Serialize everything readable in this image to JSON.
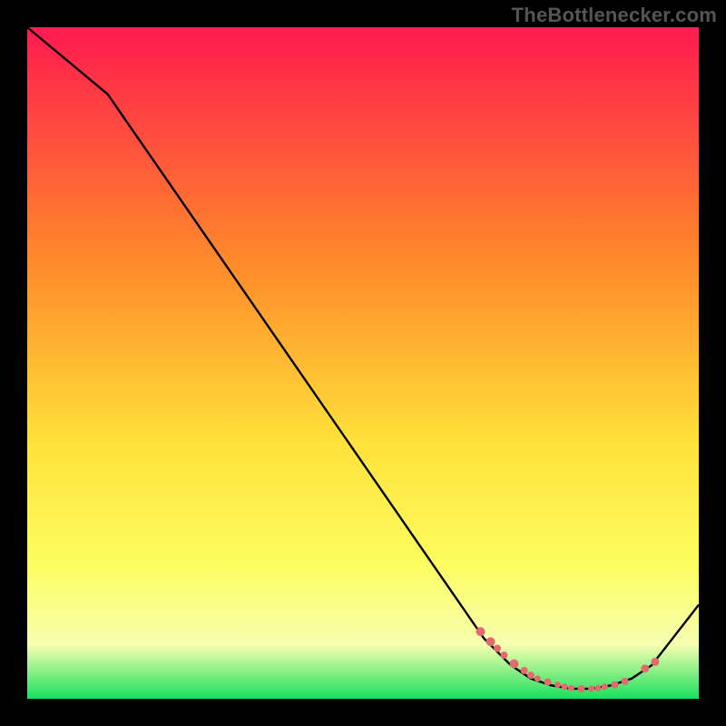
{
  "attribution": "TheBottlenecker.com",
  "colors": {
    "bg": "#000000",
    "gradient_top": "#ff1a4f",
    "gradient_mid1": "#ff8a2a",
    "gradient_mid2": "#ffe23a",
    "gradient_yellow": "#fdfd60",
    "gradient_pale": "#f6ffb0",
    "gradient_bottom": "#18e05b",
    "line": "#000000",
    "marker": "#e46a6d"
  },
  "chart_data": {
    "type": "line",
    "title": "",
    "xlabel": "",
    "ylabel": "",
    "xlim": [
      0,
      100
    ],
    "ylim": [
      0,
      100
    ],
    "series": [
      {
        "name": "curve",
        "x": [
          0,
          12,
          68,
          72,
          75,
          78,
          81,
          84,
          87,
          90,
          93,
          100
        ],
        "y": [
          100,
          90,
          9,
          5,
          3,
          2,
          1.5,
          1.5,
          2,
          3,
          5,
          14
        ]
      }
    ],
    "markers": {
      "name": "highlight",
      "x": [
        67.5,
        69,
        70,
        71,
        72.5,
        74,
        75,
        76,
        77.5,
        79,
        80,
        81,
        82.5,
        84,
        85,
        86,
        87.5,
        89,
        92,
        93.5
      ],
      "y": [
        10,
        8.5,
        7.5,
        6.5,
        5.2,
        4.2,
        3.5,
        3,
        2.5,
        2.1,
        1.8,
        1.6,
        1.5,
        1.5,
        1.6,
        1.8,
        2.1,
        2.6,
        4.5,
        5.5
      ],
      "r": [
        5,
        5,
        4,
        4,
        5,
        4,
        4,
        3.5,
        4,
        3.5,
        3.5,
        3.5,
        4,
        3.5,
        3.5,
        3.5,
        4,
        4,
        4.5,
        4.5
      ]
    }
  }
}
